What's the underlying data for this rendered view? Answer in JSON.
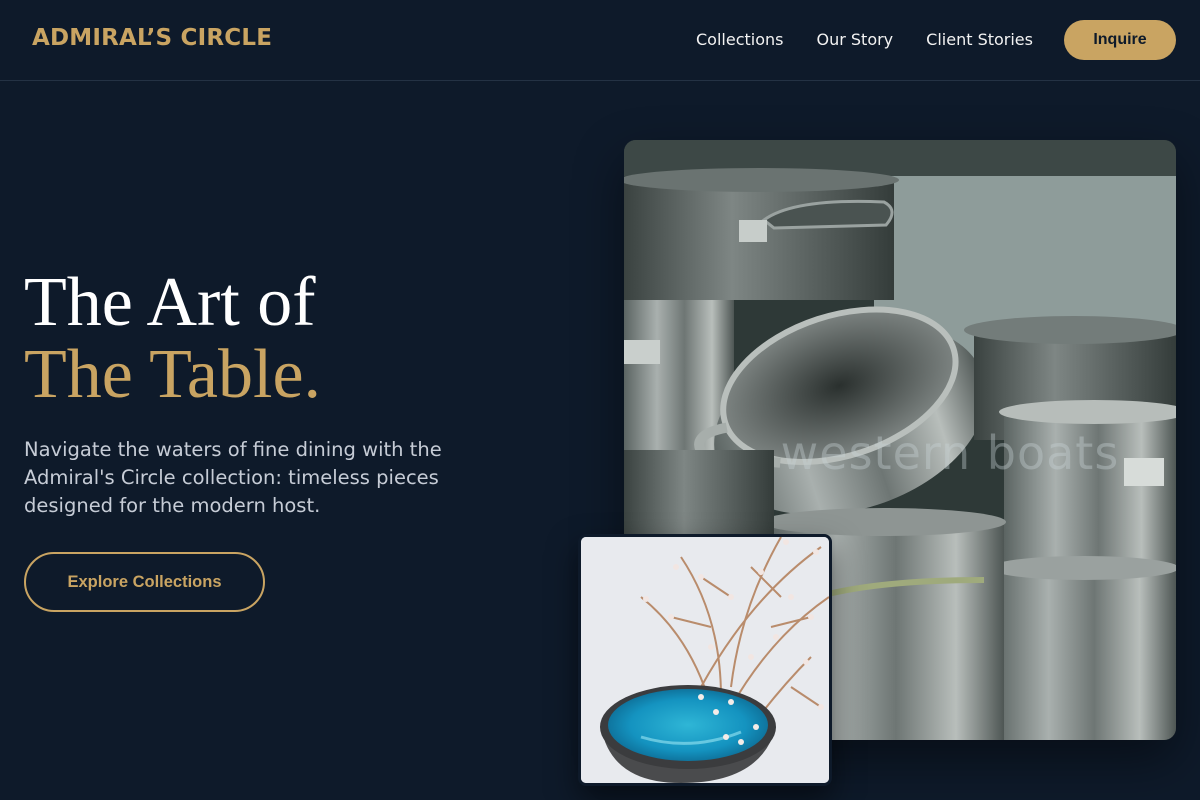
{
  "header": {
    "brand": "ADMIRAL’S CIRCLE",
    "nav": [
      "Collections",
      "Our Story",
      "Client Stories"
    ],
    "cta": "Inquire"
  },
  "hero": {
    "title_line1": "The Art of",
    "title_line2": "The Table.",
    "subtitle": "Navigate the waters of fine dining with the Admiral's Circle collection: timeless pieces designed for the modern host.",
    "button": "Explore Collections"
  },
  "images": {
    "main_watermark": "western boats"
  },
  "colors": {
    "background": "#0e1a2a",
    "accent": "#c9a462",
    "text": "#ffffff"
  }
}
